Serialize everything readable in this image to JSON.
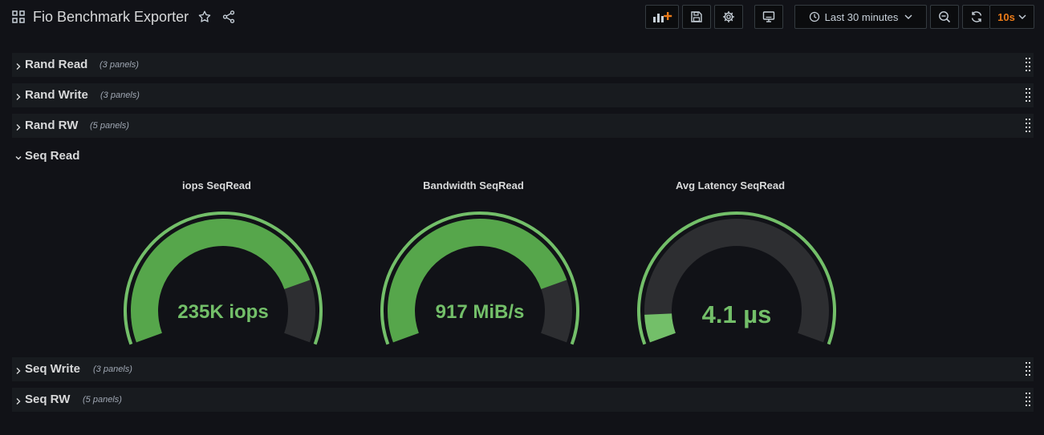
{
  "header": {
    "title": "Fio Benchmark Exporter",
    "time_range": "Last 30 minutes",
    "refresh_interval": "10s"
  },
  "rows": [
    {
      "title": "Rand Read",
      "count": "(3 panels)",
      "collapsed": true
    },
    {
      "title": "Rand Write",
      "count": "(3 panels)",
      "collapsed": true
    },
    {
      "title": "Rand RW",
      "count": "(5 panels)",
      "collapsed": true
    },
    {
      "title": "Seq Read",
      "count": "",
      "collapsed": false
    },
    {
      "title": "Seq Write",
      "count": "(3 panels)",
      "collapsed": true
    },
    {
      "title": "Seq RW",
      "count": "(5 panels)",
      "collapsed": true
    }
  ],
  "panels": [
    {
      "title": "iops SeqRead",
      "value": "235K iops",
      "fill_fraction": 0.82
    },
    {
      "title": "Bandwidth SeqRead",
      "value": "917 MiB/s",
      "fill_fraction": 0.82
    },
    {
      "title": "Avg Latency SeqRead",
      "value": "4.1 µs",
      "fill_fraction": 0.08
    }
  ],
  "colors": {
    "background": "#111217",
    "row_background": "#181b1f",
    "gauge_green": "#56a64b",
    "gauge_light_green": "#73bf69",
    "gauge_track": "#2d2e31",
    "refresh_orange": "#eb7b18"
  },
  "icons": {
    "dashboard": "grid-icon",
    "star": "star-icon",
    "share": "share-icon",
    "add_panel": "add-panel-icon",
    "save": "save-icon",
    "settings": "gear-icon",
    "tv_mode": "monitor-icon",
    "clock": "clock-icon",
    "zoom_out": "zoom-out-icon",
    "refresh": "refresh-icon",
    "drag": "drag-handle-icon"
  }
}
